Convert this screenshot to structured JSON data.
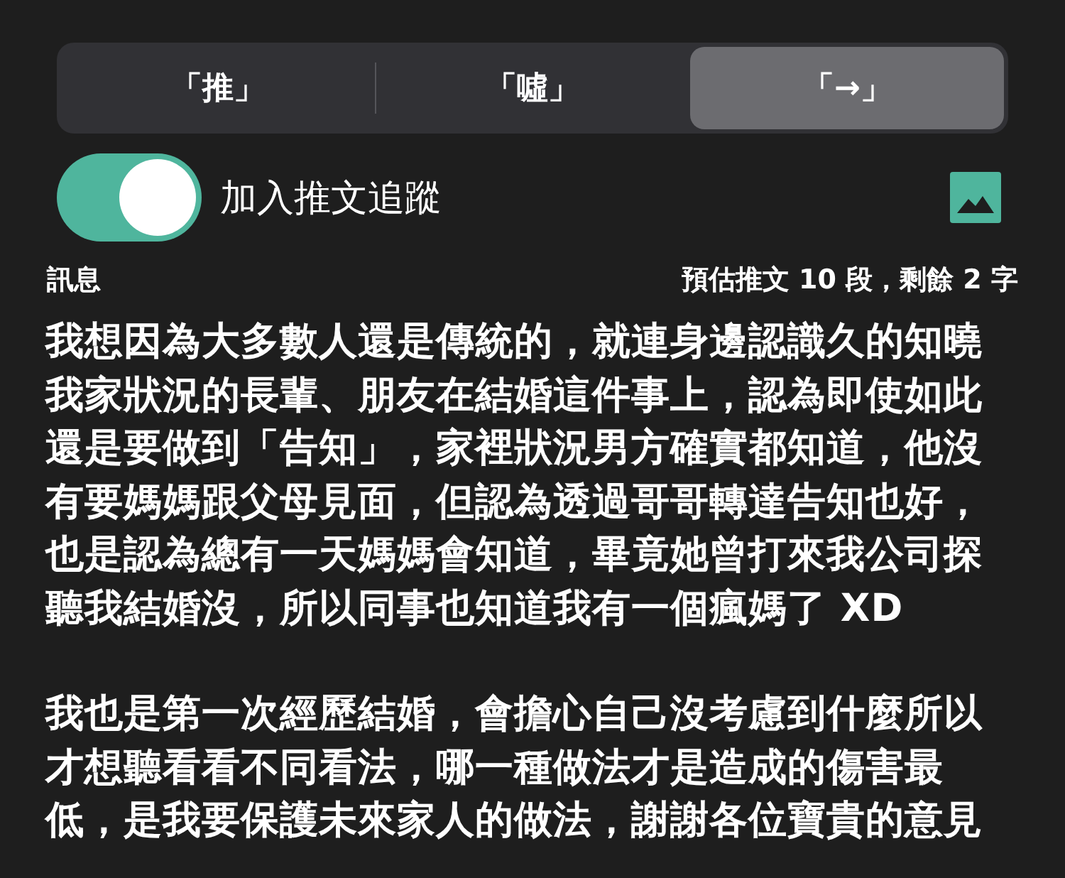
{
  "segments": [
    {
      "label": "「推」",
      "selected": false
    },
    {
      "label": "「噓」",
      "selected": false
    },
    {
      "label": "「→」",
      "selected": true
    }
  ],
  "follow_toggle": {
    "label": "加入推文追蹤",
    "on": true
  },
  "message_label": "訊息",
  "estimate": "預估推文 10 段，剩餘 2 字",
  "paragraphs": [
    {
      "lines": [
        "我想因為大多數人還是傳統的，就連身邊認識久的知曉",
        "我家狀況的長輩、朋友在結婚這件事上，認為即使如此",
        "還是要做到「告知」，家裡狀況男方確實都知道，他沒",
        "有要媽媽跟父母見面，但認為透過哥哥轉達告知也好，",
        "也是認為總有一天媽媽會知道，畢竟她曾打來我公司探",
        "聽我結婚沒，所以同事也知道我有一個瘋媽了 XD"
      ]
    },
    {
      "lines": [
        "我也是第一次經歷結婚，會擔心自己沒考慮到什麼所以",
        "才想聽看看不同看法，哪一種做法才是造成的傷害最",
        "低，是我要保護未來家人的做法，謝謝各位寶貴的意見"
      ]
    }
  ]
}
